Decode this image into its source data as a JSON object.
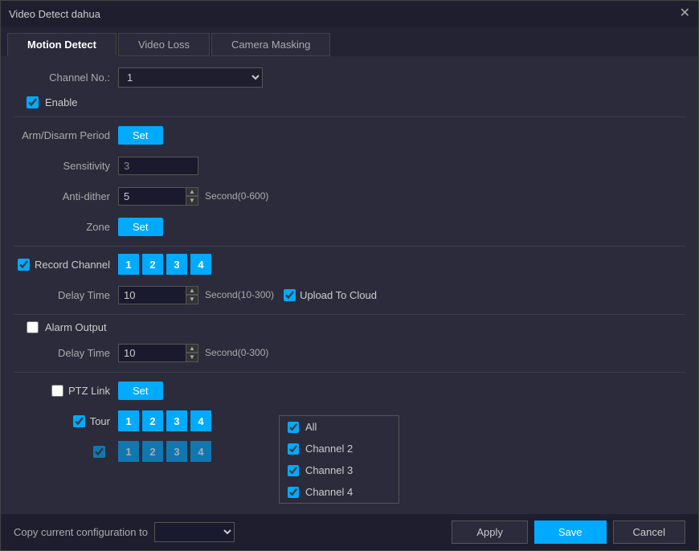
{
  "dialog": {
    "title": "Video Detect dahua"
  },
  "tabs": [
    {
      "label": "Motion Detect",
      "active": true
    },
    {
      "label": "Video Loss",
      "active": false
    },
    {
      "label": "Camera Masking",
      "active": false
    }
  ],
  "form": {
    "channel_no_label": "Channel No.:",
    "channel_no_value": "1",
    "enable_label": "Enable",
    "enable_checked": true,
    "arm_disarm_label": "Arm/Disarm Period",
    "set_label": "Set",
    "sensitivity_label": "Sensitivity",
    "sensitivity_value": "3",
    "anti_dither_label": "Anti-dither",
    "anti_dither_value": "5",
    "anti_dither_helper": "Second(0-600)",
    "zone_label": "Zone",
    "zone_set_label": "Set",
    "record_channel_label": "Record Channel",
    "record_channel_checked": true,
    "record_channels": [
      "1",
      "2",
      "3",
      "4"
    ],
    "delay_time_label": "Delay Time",
    "delay_time_value": "10",
    "delay_time_helper": "Second(10-300)",
    "upload_cloud_label": "Upload To Cloud",
    "upload_cloud_checked": true,
    "alarm_output_label": "Alarm Output",
    "alarm_output_checked": false,
    "alarm_delay_label": "Delay Time",
    "alarm_delay_value": "10",
    "alarm_delay_helper": "Second(0-300)",
    "ptz_link_label": "PTZ Link",
    "ptz_link_checked": false,
    "ptz_set_label": "Set",
    "tour_label": "Tour",
    "tour_checked": true,
    "tour_channels": [
      "1",
      "2",
      "3",
      "4"
    ]
  },
  "footer": {
    "copy_label": "Copy current configuration to",
    "apply_label": "Apply",
    "save_label": "Save",
    "cancel_label": "Cancel"
  },
  "dropdown": {
    "items": [
      {
        "label": "All",
        "checked": true
      },
      {
        "label": "Channel 2",
        "checked": true
      },
      {
        "label": "Channel 3",
        "checked": true
      },
      {
        "label": "Channel 4",
        "checked": true
      }
    ]
  }
}
